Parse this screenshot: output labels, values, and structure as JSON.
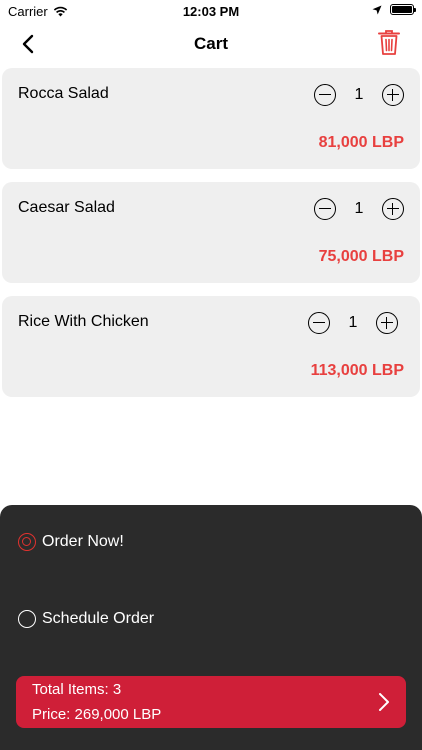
{
  "status_bar": {
    "carrier": "Carrier",
    "time": "12:03 PM"
  },
  "nav": {
    "title": "Cart"
  },
  "cart": {
    "items": [
      {
        "name": "Rocca Salad",
        "quantity": "1",
        "price": "81,000 LBP"
      },
      {
        "name": "Caesar Salad",
        "quantity": "1",
        "price": "75,000 LBP"
      },
      {
        "name": "Rice With Chicken",
        "quantity": "1",
        "price": "113,000 LBP"
      }
    ]
  },
  "order_options": {
    "order_now_label": "Order Now!",
    "schedule_label": "Schedule Order",
    "selected": "order_now"
  },
  "checkout": {
    "total_items_text": "Total Items: 3",
    "price_text": "Price: 269,000 LBP"
  },
  "colors": {
    "accent": "#e8403f",
    "checkout_bg": "#cf1f38",
    "sheet_bg": "#2b2b2b",
    "card_bg": "#efefef"
  },
  "icons": {
    "back": "chevron-left-icon",
    "trash": "trash-icon",
    "wifi": "wifi-icon",
    "location": "location-arrow-icon",
    "battery": "battery-icon",
    "checkout": "chevron-right-icon"
  }
}
